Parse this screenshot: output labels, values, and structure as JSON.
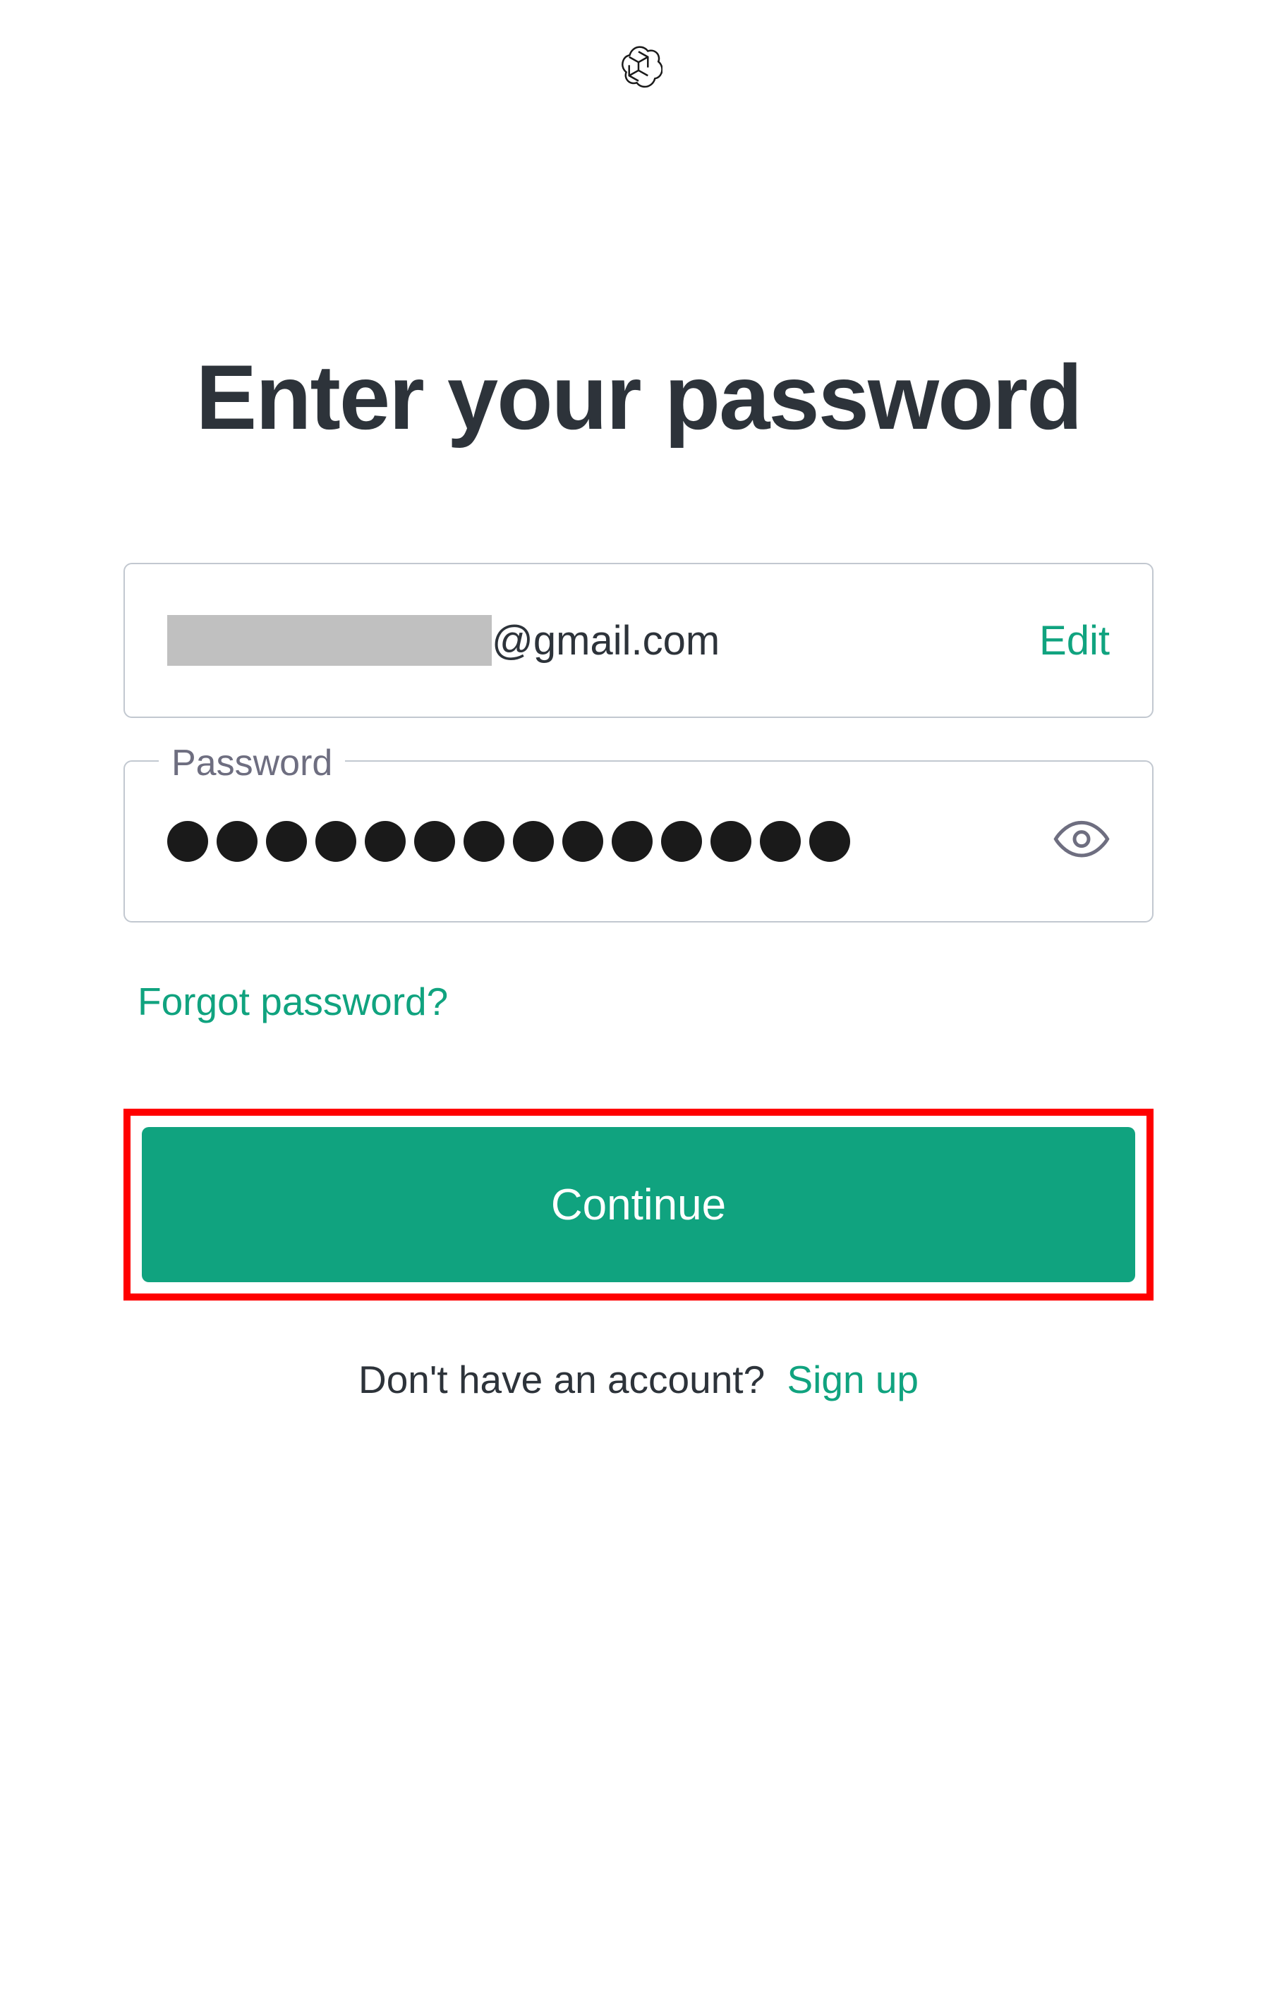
{
  "header": {
    "title": "Enter your password"
  },
  "email": {
    "domain": "@gmail.com",
    "edit_label": "Edit"
  },
  "password": {
    "label": "Password",
    "dot_count": 14
  },
  "links": {
    "forgot_password": "Forgot password?",
    "signup_prompt": "Don't have an account?",
    "signup_label": "Sign up"
  },
  "buttons": {
    "continue": "Continue"
  },
  "colors": {
    "accent": "#10a37f",
    "highlight": "#ff0000",
    "text_dark": "#2d333a",
    "text_muted": "#6e6e80",
    "border": "#c2c8d0"
  }
}
